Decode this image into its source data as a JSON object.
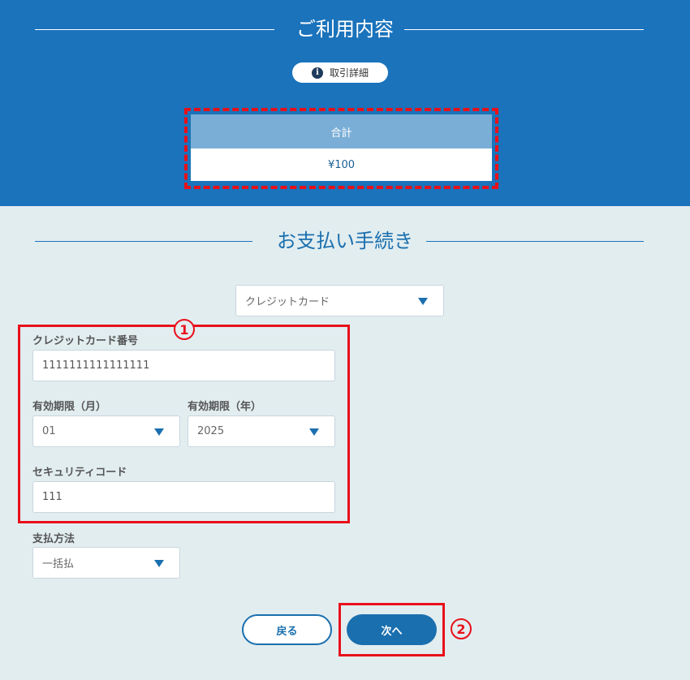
{
  "usage": {
    "title": "ご利用内容",
    "detail_button_label": "取引詳細",
    "total_header": "合計",
    "total_value": "¥100"
  },
  "payment": {
    "title": "お支払い手続き",
    "method_select_value": "クレジットカード",
    "card_number_label": "クレジットカード番号",
    "card_number_value": "1111111111111111",
    "expiry_month_label": "有効期限（月）",
    "expiry_month_value": "01",
    "expiry_year_label": "有効期限（年）",
    "expiry_year_value": "2025",
    "security_code_label": "セキュリティコード",
    "security_code_value": "111",
    "pay_method_label": "支払方法",
    "pay_method_value": "一括払"
  },
  "buttons": {
    "back_label": "戻る",
    "next_label": "次へ"
  },
  "annotations": {
    "marker_1": "1",
    "marker_2": "2"
  },
  "colors": {
    "header_blue": "#1a73bb",
    "accent_blue": "#1a6fae",
    "highlight_red": "#e8101a",
    "background": "#e2edf0"
  }
}
